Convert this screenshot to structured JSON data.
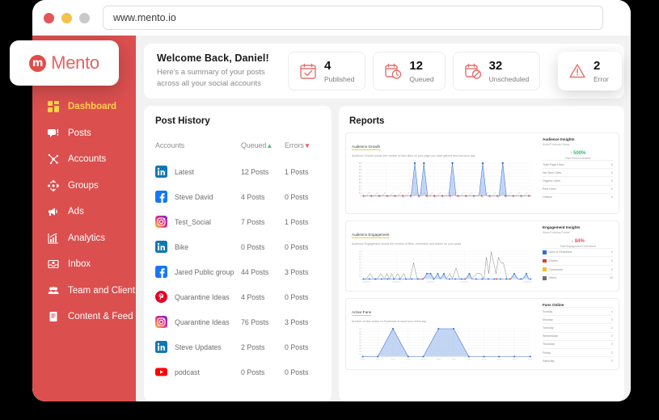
{
  "browser": {
    "url": "www.mento.io",
    "dots": [
      "close",
      "minimize",
      "maximize"
    ]
  },
  "brand": {
    "mark": "m",
    "name": "Mento"
  },
  "sidebar": {
    "items": [
      {
        "label": "Dashboard",
        "icon": "grid-icon",
        "active": true
      },
      {
        "label": "Posts",
        "icon": "posts-icon",
        "active": false
      },
      {
        "label": "Accounts",
        "icon": "accounts-icon",
        "active": false
      },
      {
        "label": "Groups",
        "icon": "groups-icon",
        "active": false
      },
      {
        "label": "Ads",
        "icon": "megaphone-icon",
        "active": false
      },
      {
        "label": "Analytics",
        "icon": "analytics-icon",
        "active": false
      },
      {
        "label": "Inbox",
        "icon": "inbox-icon",
        "active": false
      },
      {
        "label": "Team and Client",
        "icon": "team-icon",
        "active": false
      },
      {
        "label": "Content & Feed",
        "icon": "content-icon",
        "active": false
      }
    ]
  },
  "welcome": {
    "title": "Welcome Back, Daniel!",
    "subtitle": "Here's a summary of your posts across all your social accounts"
  },
  "stats": [
    {
      "value": "4",
      "label": "Published",
      "icon": "calendar-check-icon"
    },
    {
      "value": "12",
      "label": "Queued",
      "icon": "calendar-clock-icon"
    },
    {
      "value": "32",
      "label": "Unscheduled",
      "icon": "calendar-block-icon"
    }
  ],
  "error_stat": {
    "value": "2",
    "label": "Error",
    "icon": "warning-triangle-icon"
  },
  "post_history": {
    "title": "Post History",
    "columns": [
      {
        "label": "Accounts",
        "sort": ""
      },
      {
        "label": "Queued",
        "sort": "up"
      },
      {
        "label": "Errors",
        "sort": "down"
      }
    ],
    "rows": [
      {
        "network": "linkedin",
        "name": "Latest",
        "queued": "12 Posts",
        "errors": "1 Posts"
      },
      {
        "network": "facebook",
        "name": "Steve David",
        "queued": "4 Posts",
        "errors": "0 Posts"
      },
      {
        "network": "instagram",
        "name": "Test_Social",
        "queued": "7 Posts",
        "errors": "1 Posts"
      },
      {
        "network": "linkedin",
        "name": "Bike",
        "queued": "0 Posts",
        "errors": "0 Posts"
      },
      {
        "network": "facebook",
        "name": "Jared Public group",
        "queued": "44 Posts",
        "errors": "3 Posts"
      },
      {
        "network": "pinterest",
        "name": "Quarantine Ideas",
        "queued": "4 Posts",
        "errors": "0 Posts"
      },
      {
        "network": "instagram",
        "name": "Quarantine Ideas",
        "queued": "76 Posts",
        "errors": "3 Posts"
      },
      {
        "network": "linkedin",
        "name": "Steve Updates",
        "queued": "2 Posts",
        "errors": "0 Posts"
      },
      {
        "network": "youtube",
        "name": "podcast",
        "queued": "0 Posts",
        "errors": "0 Posts"
      }
    ]
  },
  "reports": {
    "title": "Reports",
    "audience_growth": {
      "title": "Audience Growth",
      "description": "Audience Growth shows the number of fans likes on your page you have gained and lost each day.",
      "insights": {
        "title": "Audience Insights",
        "subtitle": "Since Previous Period",
        "delta": "↑ 500%",
        "delta_direction": "up",
        "caption": "Total Fans Increased",
        "rows": [
          {
            "name": "Total Page Likes",
            "value": "6"
          },
          {
            "name": "Net New Likes",
            "value": "5"
          },
          {
            "name": "Organic Likes",
            "value": "5"
          },
          {
            "name": "Paid Likes",
            "value": "0"
          },
          {
            "name": "Unlikes",
            "value": "0"
          }
        ]
      }
    },
    "audience_engagement": {
      "title": "Audience Engagement",
      "description": "Audience Engagement shows the number of likes, comments and shares on your posts.",
      "insights": {
        "title": "Engagement Insights",
        "subtitle": "Since Previous Period",
        "delta": "↓ 84%",
        "delta_direction": "down",
        "caption": "Total Engagement Decreased",
        "rows": [
          {
            "name": "Likes & Reactions",
            "value": "0",
            "color": "#2b6fe0"
          },
          {
            "name": "Shares",
            "value": "0",
            "color": "#e03b2b"
          },
          {
            "name": "Comments",
            "value": "0",
            "color": "#f2c029"
          },
          {
            "name": "Offers",
            "value": "40",
            "color": "#6e6e6e"
          }
        ]
      }
    },
    "active_fans": {
      "title": "Active Fans",
      "description": "Number of fans active on Facebook at each hour of the day.",
      "insights": {
        "title": "Fans Online",
        "rows": [
          {
            "name": "Sunday",
            "value": "4"
          },
          {
            "name": "Monday",
            "value": "3"
          },
          {
            "name": "Tuesday",
            "value": "2"
          },
          {
            "name": "Wednesday",
            "value": "2"
          },
          {
            "name": "Thursday",
            "value": "3"
          },
          {
            "name": "Friday",
            "value": "2"
          },
          {
            "name": "Saturday",
            "value": "2"
          }
        ]
      }
    }
  },
  "chart_data": [
    {
      "type": "line",
      "title": "Audience Growth",
      "xlabel": "",
      "ylabel": "",
      "ylim": [
        0,
        1.0
      ],
      "yticks": [
        0,
        0.1,
        0.2,
        0.3,
        0.4,
        0.5,
        0.6,
        0.7,
        0.8,
        0.9,
        1.0
      ],
      "x": [
        "2020-04-28",
        "2020-05-02",
        "2020-05-06",
        "2020-05-11",
        "2020-05-15",
        "2020-05-19",
        "2020-05-24",
        "2020-05-28",
        "2020-06-01",
        "2020-06-06",
        "2020-06-10",
        "2020-06-14",
        "2020-06-19",
        "2020-06-23",
        "2020-06-28",
        "2020-07-02",
        "2020-07-06",
        "2020-07-11",
        "2020-07-15",
        "2020-07-19",
        "2020-07-24"
      ],
      "series": [
        {
          "name": "New Likes",
          "color": "#3b6fd4",
          "values": [
            0,
            0,
            0,
            0,
            0,
            0,
            1,
            1,
            0,
            0,
            0,
            0,
            1,
            0,
            0,
            0,
            1,
            0,
            1,
            0,
            0
          ]
        },
        {
          "name": "Unlikes",
          "color": "#e8392b",
          "values": [
            0,
            0,
            0,
            0,
            0,
            0,
            0,
            0,
            0,
            0,
            0,
            0,
            0,
            0,
            0,
            0,
            0,
            0,
            0,
            0,
            0
          ]
        }
      ],
      "grid": true,
      "legend": "none"
    },
    {
      "type": "line",
      "title": "Audience Engagement",
      "xlabel": "",
      "ylabel": "",
      "ylim": [
        0,
        5.0
      ],
      "yticks": [
        0,
        0.5,
        1.0,
        1.5,
        2.0,
        2.5,
        3.0,
        3.5,
        4.0,
        4.5,
        5.0
      ],
      "x": [
        "2020-04-28",
        "2020-05-10",
        "2020-06-01",
        "2020-06-10",
        "2020-07-24"
      ],
      "series": [
        {
          "name": "Likes & Reactions",
          "color": "#2b6fe0",
          "values": [
            0,
            1,
            1,
            1,
            0
          ]
        },
        {
          "name": "Shares",
          "color": "#e03b2b",
          "values": [
            0,
            0,
            0,
            0,
            0
          ]
        },
        {
          "name": "Comments",
          "color": "#f2c029",
          "values": [
            0,
            0,
            0,
            0,
            0
          ]
        },
        {
          "name": "Offers",
          "color": "#6e6e6e",
          "values": [
            1,
            3,
            2,
            5,
            0
          ]
        }
      ],
      "grid": true,
      "legend": "right"
    },
    {
      "type": "area",
      "title": "Active Fans",
      "xlabel": "",
      "ylabel": "",
      "ylim": [
        0,
        1.0
      ],
      "yticks": [
        0,
        0.1,
        0.2,
        0.3,
        0.4,
        0.5,
        0.6,
        0.7,
        0.8,
        0.9,
        1.0
      ],
      "x": [
        "00:00",
        "02:00",
        "04:00",
        "06:00",
        "08:00",
        "10:00",
        "12:00",
        "14:00",
        "16:00",
        "18:00",
        "21:00",
        "22:00"
      ],
      "series": [
        {
          "name": "Active Fans",
          "color": "#3b6fd4",
          "values": [
            0,
            0,
            1,
            0,
            0,
            1,
            1,
            0,
            0,
            0,
            0,
            0
          ]
        }
      ],
      "grid": true,
      "legend": "none"
    }
  ]
}
